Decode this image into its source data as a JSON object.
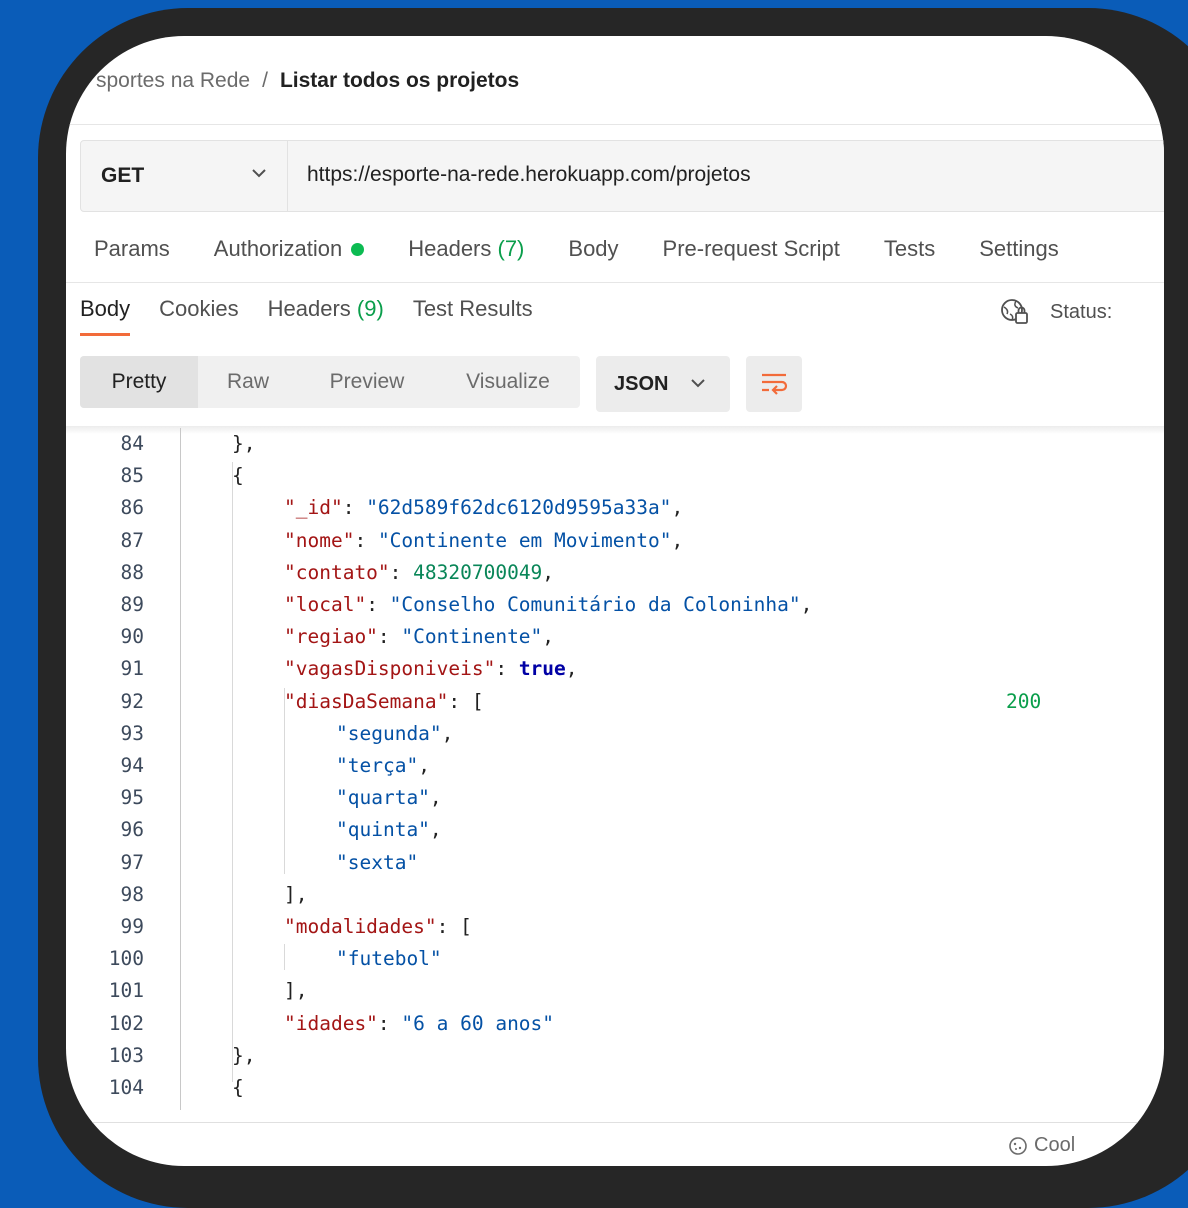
{
  "breadcrumb": {
    "parent": "sportes na Rede",
    "separator": "/",
    "current": "Listar todos os projetos"
  },
  "request": {
    "method": "GET",
    "url": "https://esporte-na-rede.herokuapp.com/projetos"
  },
  "request_tabs": {
    "params": "Params",
    "authorization": "Authorization",
    "headers": "Headers",
    "headers_count": "(7)",
    "body": "Body",
    "prerequest": "Pre-request Script",
    "tests": "Tests",
    "settings": "Settings"
  },
  "response_tabs": {
    "body": "Body",
    "cookies": "Cookies",
    "headers": "Headers",
    "headers_count": "(9)",
    "test_results": "Test Results"
  },
  "status": {
    "label": "Status:",
    "code": "200"
  },
  "view_modes": {
    "pretty": "Pretty",
    "raw": "Raw",
    "preview": "Preview",
    "visualize": "Visualize"
  },
  "format": {
    "selected": "JSON"
  },
  "colors": {
    "accent": "#f26b3a",
    "success": "#0a9e4b",
    "key": "#a31515",
    "string": "#0451a5",
    "number": "#098658"
  },
  "code_lines": [
    {
      "n": "84",
      "indent": 1,
      "tokens": [
        [
          "p",
          "},"
        ]
      ]
    },
    {
      "n": "85",
      "indent": 1,
      "tokens": [
        [
          "p",
          "{"
        ]
      ]
    },
    {
      "n": "86",
      "indent": 2,
      "tokens": [
        [
          "k",
          "\"_id\""
        ],
        [
          "p",
          ": "
        ],
        [
          "s",
          "\"62d589f62dc6120d9595a33a\""
        ],
        [
          "p",
          ","
        ]
      ]
    },
    {
      "n": "87",
      "indent": 2,
      "tokens": [
        [
          "k",
          "\"nome\""
        ],
        [
          "p",
          ": "
        ],
        [
          "s",
          "\"Continente em Movimento\""
        ],
        [
          "p",
          ","
        ]
      ]
    },
    {
      "n": "88",
      "indent": 2,
      "tokens": [
        [
          "k",
          "\"contato\""
        ],
        [
          "p",
          ": "
        ],
        [
          "n",
          "48320700049"
        ],
        [
          "p",
          ","
        ]
      ]
    },
    {
      "n": "89",
      "indent": 2,
      "tokens": [
        [
          "k",
          "\"local\""
        ],
        [
          "p",
          ": "
        ],
        [
          "s",
          "\"Conselho Comunitário da Coloninha\""
        ],
        [
          "p",
          ","
        ]
      ]
    },
    {
      "n": "90",
      "indent": 2,
      "tokens": [
        [
          "k",
          "\"regiao\""
        ],
        [
          "p",
          ": "
        ],
        [
          "s",
          "\"Continente\""
        ],
        [
          "p",
          ","
        ]
      ]
    },
    {
      "n": "91",
      "indent": 2,
      "tokens": [
        [
          "k",
          "\"vagasDisponiveis\""
        ],
        [
          "p",
          ": "
        ],
        [
          "b",
          "true"
        ],
        [
          "p",
          ","
        ]
      ]
    },
    {
      "n": "92",
      "indent": 2,
      "tokens": [
        [
          "k",
          "\"diasDaSemana\""
        ],
        [
          "p",
          ": ["
        ]
      ]
    },
    {
      "n": "93",
      "indent": 3,
      "tokens": [
        [
          "s",
          "\"segunda\""
        ],
        [
          "p",
          ","
        ]
      ]
    },
    {
      "n": "94",
      "indent": 3,
      "tokens": [
        [
          "s",
          "\"terça\""
        ],
        [
          "p",
          ","
        ]
      ]
    },
    {
      "n": "95",
      "indent": 3,
      "tokens": [
        [
          "s",
          "\"quarta\""
        ],
        [
          "p",
          ","
        ]
      ]
    },
    {
      "n": "96",
      "indent": 3,
      "tokens": [
        [
          "s",
          "\"quinta\""
        ],
        [
          "p",
          ","
        ]
      ]
    },
    {
      "n": "97",
      "indent": 3,
      "tokens": [
        [
          "s",
          "\"sexta\""
        ]
      ]
    },
    {
      "n": "98",
      "indent": 2,
      "tokens": [
        [
          "p",
          "],"
        ]
      ]
    },
    {
      "n": "99",
      "indent": 2,
      "tokens": [
        [
          "k",
          "\"modalidades\""
        ],
        [
          "p",
          ": ["
        ]
      ]
    },
    {
      "n": "100",
      "indent": 3,
      "tokens": [
        [
          "s",
          "\"futebol\""
        ]
      ]
    },
    {
      "n": "101",
      "indent": 2,
      "tokens": [
        [
          "p",
          "],"
        ]
      ]
    },
    {
      "n": "102",
      "indent": 2,
      "tokens": [
        [
          "k",
          "\"idades\""
        ],
        [
          "p",
          ": "
        ],
        [
          "s",
          "\"6 a 60 anos\""
        ]
      ]
    },
    {
      "n": "103",
      "indent": 1,
      "tokens": [
        [
          "p",
          "},"
        ]
      ]
    },
    {
      "n": "104",
      "indent": 1,
      "tokens": [
        [
          "p",
          "{"
        ]
      ]
    }
  ],
  "footer": {
    "cookies_label": "Cool"
  }
}
